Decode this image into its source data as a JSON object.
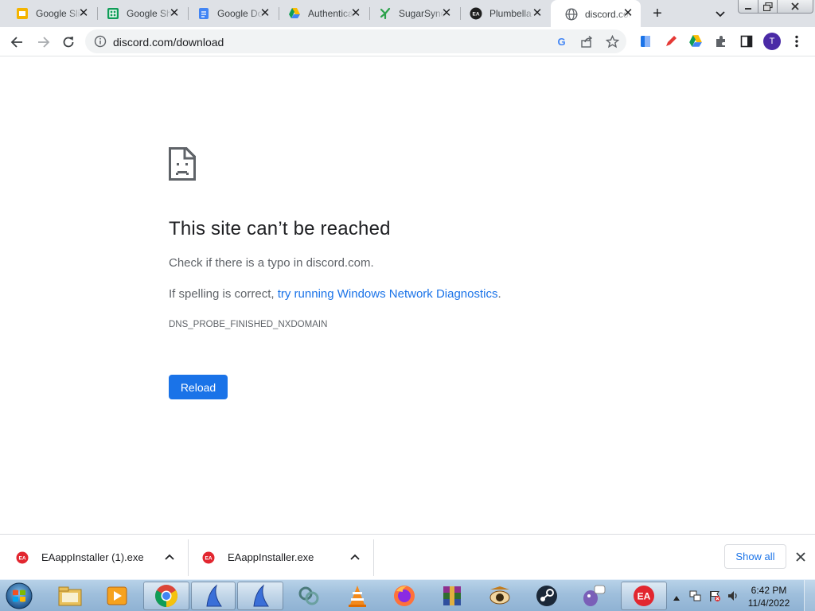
{
  "browser": {
    "tabs": [
      {
        "title": "Google Slides",
        "icon": "google-slides-icon"
      },
      {
        "title": "Google Sheets",
        "icon": "google-sheets-icon"
      },
      {
        "title": "Google Docs",
        "icon": "google-docs-icon"
      },
      {
        "title": "Authentication",
        "icon": "google-drive-icon"
      },
      {
        "title": "SugarSync",
        "icon": "sugarsync-icon"
      },
      {
        "title": "Plumbella",
        "icon": "ea-icon"
      },
      {
        "title": "discord.com",
        "icon": "globe-icon",
        "active": true
      }
    ],
    "address_bar": {
      "url": "discord.com/download"
    },
    "profile_initial": "T"
  },
  "error_page": {
    "title": "This site can’t be reached",
    "line1": "Check if there is a typo in discord.com.",
    "line2_prefix": "If spelling is correct, ",
    "line2_link": "try running Windows Network Diagnostics",
    "line2_suffix": ".",
    "error_code": "DNS_PROBE_FINISHED_NXDOMAIN",
    "reload_label": "Reload"
  },
  "download_shelf": {
    "items": [
      {
        "filename": "EAappInstaller (1).exe"
      },
      {
        "filename": "EAappInstaller.exe"
      }
    ],
    "show_all_label": "Show all"
  },
  "taskbar": {
    "apps": [
      "chrome",
      "app-blue-1",
      "app-blue-2",
      "network",
      "vlc",
      "firefox",
      "winrar",
      "spy",
      "steam",
      "pidgin",
      "ea"
    ],
    "clock_time": "6:42 PM",
    "clock_date": "11/4/2022"
  },
  "colors": {
    "accent": "#1a73e8",
    "tabstrip": "#dee1e6",
    "ea_red": "#e2262f"
  }
}
